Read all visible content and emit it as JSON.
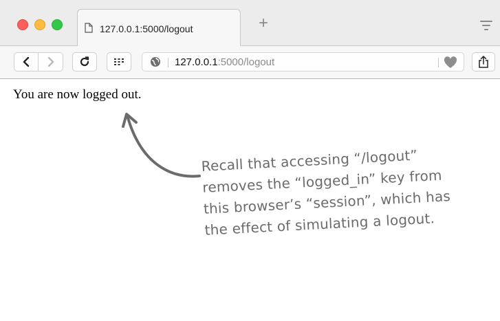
{
  "tab": {
    "title": "127.0.0.1:5000/logout",
    "icon": "page-icon"
  },
  "toolbar": {
    "url_host": "127.0.0.1",
    "url_path": ":5000/logout",
    "icons": [
      "back-icon",
      "forward-icon",
      "reload-icon",
      "grid-icon",
      "site-info-icon",
      "heart-icon",
      "share-icon"
    ]
  },
  "page": {
    "message": "You are now logged out."
  },
  "annotation": {
    "lines": [
      "Recall that accessing “/logout”",
      "removes the “logged_in” key from",
      "this browser’s “session”, which has",
      "the effect of simulating a logout."
    ]
  }
}
